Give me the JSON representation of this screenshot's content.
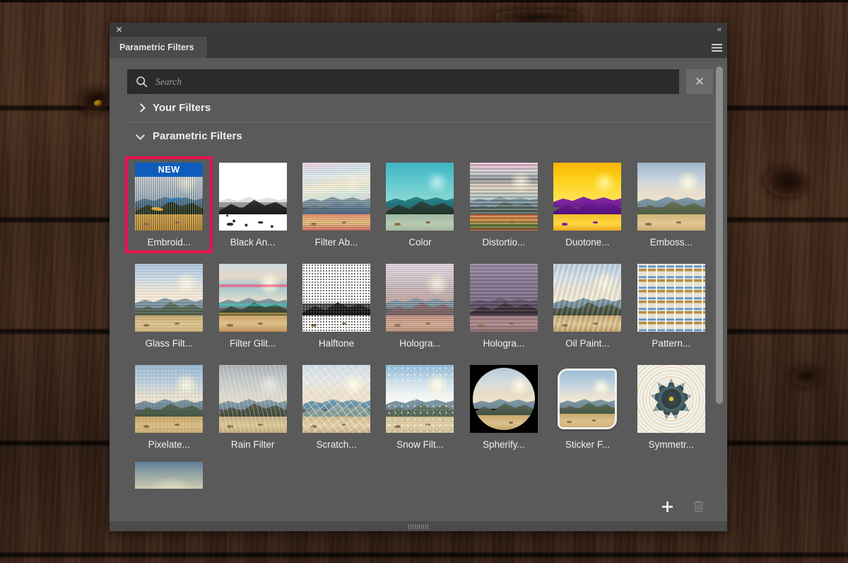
{
  "window": {
    "close_label": "✕",
    "collapse_label": "«",
    "menu_icon": "hamburger-menu-icon",
    "resize_grip": "resize-grip"
  },
  "tabs": [
    {
      "label": "Parametric Filters",
      "active": true
    }
  ],
  "search": {
    "placeholder": "Search",
    "value": "",
    "icon": "search-icon",
    "clear_label": "✕"
  },
  "sections": [
    {
      "id": "your-filters",
      "title": "Your Filters",
      "expanded": false,
      "chevron": "chevron-right-icon"
    },
    {
      "id": "parametric-filters",
      "title": "Parametric Filters",
      "expanded": true,
      "chevron": "chevron-down-icon"
    }
  ],
  "badges": {
    "new": "NEW"
  },
  "colors": {
    "selection": "#ec0e4f",
    "new_badge": "#0e5dbd",
    "panel_bg": "#5a5a5a",
    "titlebar_bg": "#393939",
    "tab_active_bg": "#4b4b4b",
    "search_bg": "#2b2b2b",
    "scrollbar_thumb": "#8e8e8e"
  },
  "filters": [
    {
      "label": "Embroid...",
      "fx": "fx-embroider",
      "new": true,
      "selected": true
    },
    {
      "label": "Black An...",
      "fx": "fx-bw",
      "new": false,
      "selected": false
    },
    {
      "label": "Filter Ab...",
      "fx": "fx-abstract",
      "new": false,
      "selected": false
    },
    {
      "label": "Color",
      "fx": "fx-color",
      "new": false,
      "selected": false
    },
    {
      "label": "Distortio...",
      "fx": "fx-distort",
      "new": false,
      "selected": false
    },
    {
      "label": "Duotone...",
      "fx": "fx-duotone",
      "new": false,
      "selected": false
    },
    {
      "label": "Emboss...",
      "fx": "fx-emboss",
      "new": false,
      "selected": false
    },
    {
      "label": "Glass Filt...",
      "fx": "fx-glass",
      "new": false,
      "selected": false
    },
    {
      "label": "Filter Glit...",
      "fx": "fx-glitch",
      "new": false,
      "selected": false
    },
    {
      "label": "Halftone",
      "fx": "fx-halftone",
      "new": false,
      "selected": false
    },
    {
      "label": "Hologra...",
      "fx": "fx-holo1",
      "new": false,
      "selected": false
    },
    {
      "label": "Hologra...",
      "fx": "fx-holo2",
      "new": false,
      "selected": false
    },
    {
      "label": "Oil Paint...",
      "fx": "fx-oil",
      "new": false,
      "selected": false
    },
    {
      "label": "Pattern...",
      "fx": "fx-pattern",
      "new": false,
      "selected": false
    },
    {
      "label": "Pixelate...",
      "fx": "fx-pixelate",
      "new": false,
      "selected": false
    },
    {
      "label": "Rain Filter",
      "fx": "fx-rain",
      "new": false,
      "selected": false
    },
    {
      "label": "Scratch...",
      "fx": "fx-scratch",
      "new": false,
      "selected": false
    },
    {
      "label": "Snow Filt...",
      "fx": "fx-snow",
      "new": false,
      "selected": false
    },
    {
      "label": "Spherify...",
      "fx": "fx-spherify",
      "new": false,
      "selected": false
    },
    {
      "label": "Sticker F...",
      "fx": "fx-sticker",
      "new": false,
      "selected": false
    },
    {
      "label": "Symmetr...",
      "fx": "fx-symmetry",
      "new": false,
      "selected": false
    }
  ],
  "partial_row": [
    {
      "label": "",
      "fx": "fx-partial"
    }
  ],
  "footer": {
    "add_icon": "plus-icon",
    "delete_icon": "trash-icon",
    "delete_disabled": true
  }
}
